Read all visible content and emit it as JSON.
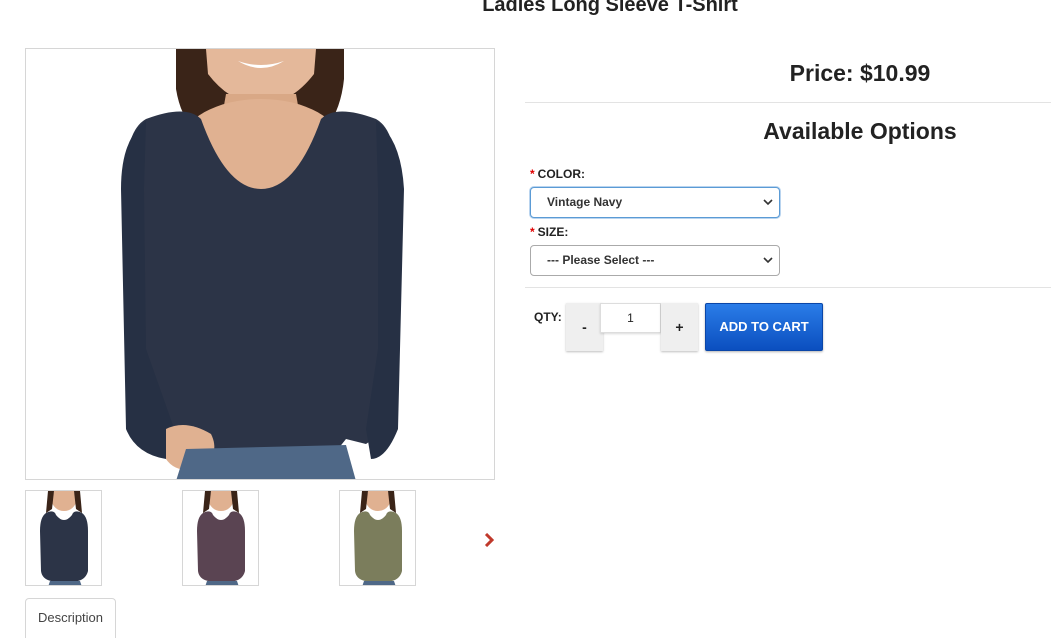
{
  "product": {
    "title": "Ladies Long Sleeve T-Shirt",
    "price": "Price: $10.99"
  },
  "gallery": {
    "main_image": {
      "subject": "woman wearing long sleeve scoop neck tee",
      "shirt_color": "#2c3447"
    },
    "thumbnails": [
      {
        "color_name": "navy",
        "shirt_color": "#2c3447"
      },
      {
        "color_name": "purple",
        "shirt_color": "#5a4452"
      },
      {
        "color_name": "olive",
        "shirt_color": "#7b7d5c"
      }
    ],
    "next_icon": "chevron-right-icon",
    "next_color": "#c0392b"
  },
  "tabs": {
    "description": "Description"
  },
  "options": {
    "heading": "Available Options",
    "required_mark": "*",
    "color": {
      "label": "COLOR:",
      "selected": "Vintage Navy"
    },
    "size": {
      "label": "SIZE:",
      "selected": "--- Please Select ---"
    }
  },
  "purchase": {
    "qty_label": "QTY:",
    "minus": "-",
    "plus": "+",
    "qty_value": "1",
    "add_to_cart": "ADD TO CART"
  },
  "colors": {
    "accent": "#0b4fbf",
    "required": "#e00000"
  }
}
